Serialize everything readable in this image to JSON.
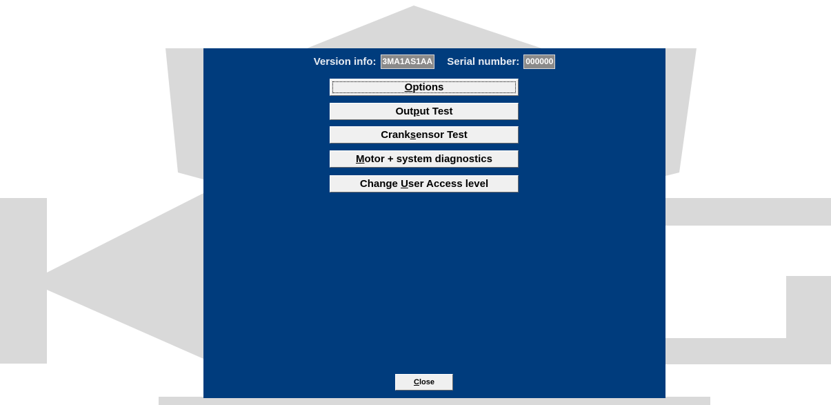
{
  "header": {
    "version_label": "Version info:",
    "version_value": "3MA1AS1AA",
    "serial_label": "Serial number:",
    "serial_value": "000000"
  },
  "menu": {
    "options": {
      "pre": "",
      "key": "O",
      "post": "ptions"
    },
    "output_test": {
      "pre": "Out",
      "key": "p",
      "post": "ut Test"
    },
    "cranksensor_test": {
      "pre": "Crank",
      "key": "s",
      "post": "ensor Test"
    },
    "motor_diagnostics": {
      "pre": "",
      "key": "M",
      "post": "otor + system diagnostics"
    },
    "change_access": {
      "pre": "Change ",
      "key": "U",
      "post": "ser Access level"
    }
  },
  "footer": {
    "close": {
      "key": "C",
      "post": "lose"
    }
  },
  "colors": {
    "panel": "#003c7d",
    "watermark": "#d9d9d9",
    "button": "#f0f0f0"
  }
}
